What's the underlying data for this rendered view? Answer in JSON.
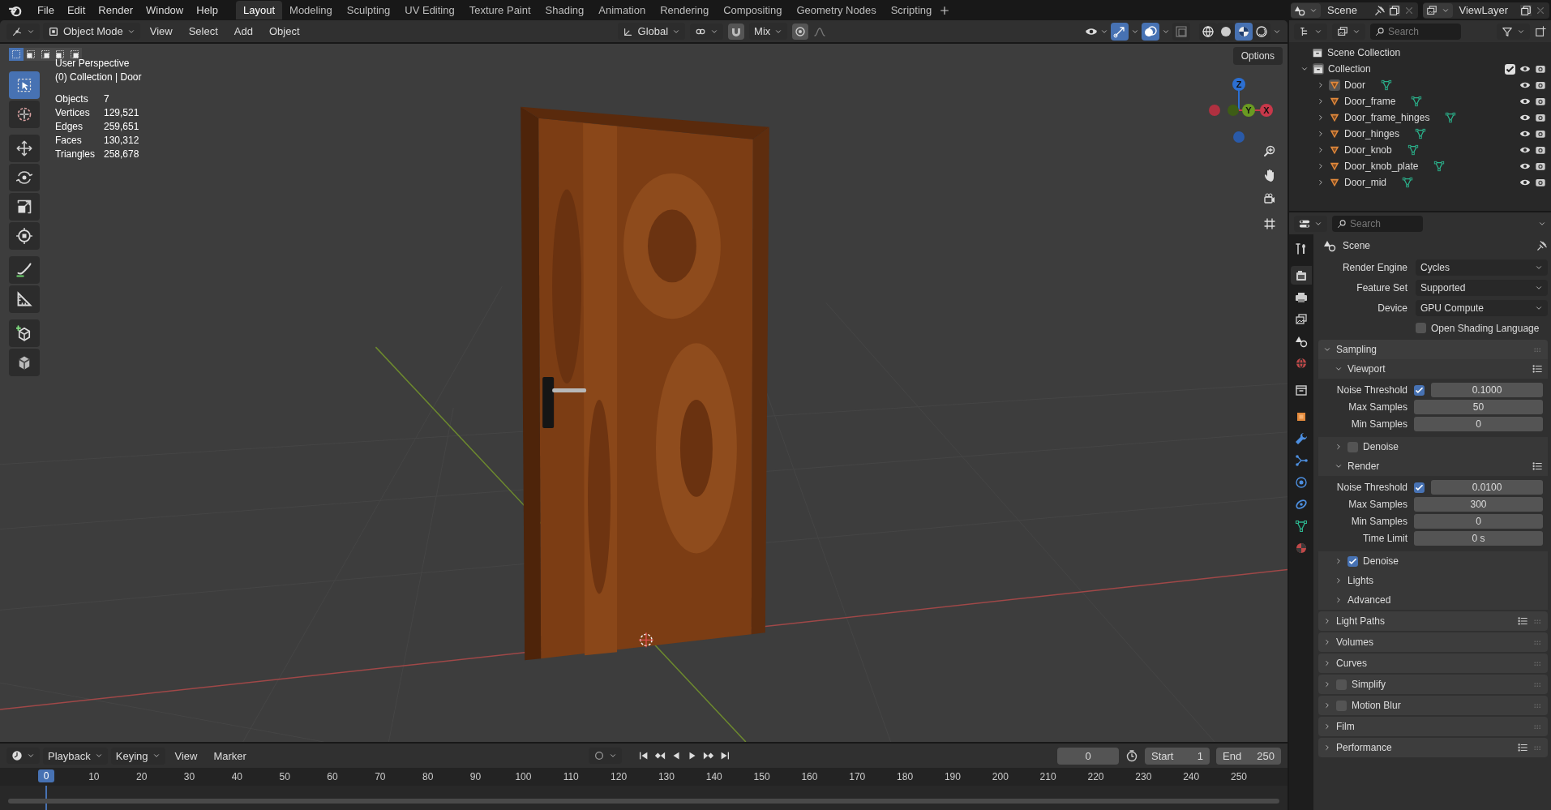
{
  "menus": [
    "File",
    "Edit",
    "Render",
    "Window",
    "Help"
  ],
  "workspaces": [
    {
      "label": "Layout",
      "selected": true
    },
    {
      "label": "Modeling",
      "selected": false
    },
    {
      "label": "Sculpting",
      "selected": false
    },
    {
      "label": "UV Editing",
      "selected": false
    },
    {
      "label": "Texture Paint",
      "selected": false
    },
    {
      "label": "Shading",
      "selected": false
    },
    {
      "label": "Animation",
      "selected": false
    },
    {
      "label": "Rendering",
      "selected": false
    },
    {
      "label": "Compositing",
      "selected": false
    },
    {
      "label": "Geometry Nodes",
      "selected": false
    },
    {
      "label": "Scripting",
      "selected": false
    }
  ],
  "scene": "Scene",
  "view_layer": "ViewLayer",
  "viewport": {
    "mode": "Object Mode",
    "menus": [
      "View",
      "Select",
      "Add",
      "Object"
    ],
    "orientation": "Global",
    "snap_target": "Mix",
    "options": "Options",
    "select_modes": [
      {
        "selected": true
      },
      {
        "selected": false
      },
      {
        "selected": false
      },
      {
        "selected": false
      },
      {
        "selected": false
      }
    ],
    "tools": [
      {
        "kind": "select",
        "selected": true
      },
      {
        "kind": "cursor",
        "selected": false
      },
      {
        "kind": "move",
        "selected": false
      },
      {
        "kind": "rotate",
        "selected": false
      },
      {
        "kind": "scale",
        "selected": false
      },
      {
        "kind": "transform",
        "selected": false
      },
      {
        "kind": "annotate",
        "selected": false
      },
      {
        "kind": "measure",
        "selected": false
      },
      {
        "kind": "add_cube",
        "selected": false
      },
      {
        "kind": "cube_edit",
        "selected": false
      }
    ],
    "header_toggles": [
      {
        "kind": "gizmo",
        "on": true
      },
      {
        "kind": "overlay",
        "on": true
      },
      {
        "kind": "xray",
        "on": false
      }
    ],
    "shading": [
      {
        "kind": "wireframe",
        "selected": false
      },
      {
        "kind": "solid",
        "selected": false
      },
      {
        "kind": "material",
        "selected": true
      },
      {
        "kind": "rendered",
        "selected": false
      }
    ],
    "view": "User Perspective",
    "context": "(0) Collection | Door",
    "stats": [
      {
        "label": "Objects",
        "value": "7"
      },
      {
        "label": "Vertices",
        "value": "129,521"
      },
      {
        "label": "Edges",
        "value": "259,651"
      },
      {
        "label": "Faces",
        "value": "130,312"
      },
      {
        "label": "Triangles",
        "value": "258,678"
      }
    ],
    "axes": [
      {
        "label": "Z",
        "color": "#2c6fd1"
      },
      {
        "label": "Y",
        "color": "#6a9a22"
      },
      {
        "label": "X",
        "color": "#c8384a"
      }
    ]
  },
  "outliner": {
    "placeholder": "Search",
    "root": "Scene Collection",
    "collection": {
      "name": "Collection",
      "expanded": true,
      "checked": true,
      "children": [
        {
          "name": "Door",
          "selected": true
        },
        {
          "name": "Door_frame",
          "selected": false
        },
        {
          "name": "Door_frame_hinges",
          "selected": false
        },
        {
          "name": "Door_hinges",
          "selected": false
        },
        {
          "name": "Door_knob",
          "selected": false
        },
        {
          "name": "Door_knob_plate",
          "selected": false
        },
        {
          "name": "Door_mid",
          "selected": false
        }
      ]
    }
  },
  "properties": {
    "placeholder": "Search",
    "context": "Scene",
    "tabs": [
      {
        "kind": "tool",
        "selected": false
      },
      {
        "kind": "render",
        "selected": true
      },
      {
        "kind": "output",
        "selected": false
      },
      {
        "kind": "view_layer",
        "selected": false
      },
      {
        "kind": "scene",
        "selected": false
      },
      {
        "kind": "world",
        "selected": false
      },
      {
        "kind": "collection",
        "selected": false
      },
      {
        "kind": "object",
        "selected": false
      },
      {
        "kind": "modifier",
        "selected": false
      },
      {
        "kind": "particles",
        "selected": false
      },
      {
        "kind": "physics",
        "selected": false
      },
      {
        "kind": "constraints",
        "selected": false
      },
      {
        "kind": "data",
        "selected": false
      },
      {
        "kind": "material",
        "selected": false
      }
    ],
    "fields": [
      {
        "label": "Render Engine",
        "value": "Cycles"
      },
      {
        "label": "Feature Set",
        "value": "Supported"
      },
      {
        "label": "Device",
        "value": "GPU Compute"
      }
    ],
    "osl": {
      "label": "Open Shading Language",
      "checked": false
    },
    "panels": [
      {
        "title": "Sampling",
        "expanded": true,
        "children": [
          {
            "title": "Viewport",
            "expanded": true,
            "presets": true,
            "rows": [
              {
                "label": "Noise Threshold",
                "checked": true,
                "value": "0.1000"
              },
              {
                "label": "Max Samples",
                "value": "50"
              },
              {
                "label": "Min Samples",
                "value": "0"
              }
            ]
          },
          {
            "title": "Denoise",
            "expanded": false,
            "checked": false
          },
          {
            "title": "Render",
            "expanded": true,
            "presets": true,
            "rows": [
              {
                "label": "Noise Threshold",
                "checked": true,
                "value": "0.0100"
              },
              {
                "label": "Max Samples",
                "value": "300"
              },
              {
                "label": "Min Samples",
                "value": "0"
              },
              {
                "label": "Time Limit",
                "value": "0 s"
              }
            ]
          },
          {
            "title": "Denoise",
            "expanded": false,
            "checked": true
          },
          {
            "title": "Lights",
            "expanded": false
          },
          {
            "title": "Advanced",
            "expanded": false
          }
        ]
      },
      {
        "title": "Light Paths",
        "expanded": false,
        "presets": true
      },
      {
        "title": "Volumes",
        "expanded": false
      },
      {
        "title": "Curves",
        "expanded": false
      },
      {
        "title": "Simplify",
        "expanded": false,
        "checked": false
      },
      {
        "title": "Motion Blur",
        "expanded": false,
        "checked": false
      },
      {
        "title": "Film",
        "expanded": false
      },
      {
        "title": "Performance",
        "expanded": false,
        "presets": true
      }
    ]
  },
  "timeline": {
    "menus": [
      "Playback",
      "Keying",
      "View",
      "Marker"
    ],
    "frame": "0",
    "start_label": "Start",
    "start": "1",
    "end_label": "End",
    "end": "250",
    "playhead": "0",
    "ticks": [
      "10",
      "20",
      "30",
      "40",
      "50",
      "60",
      "70",
      "80",
      "90",
      "100",
      "110",
      "120",
      "130",
      "140",
      "150",
      "160",
      "170",
      "180",
      "190",
      "200",
      "210",
      "220",
      "230",
      "240",
      "250"
    ]
  }
}
